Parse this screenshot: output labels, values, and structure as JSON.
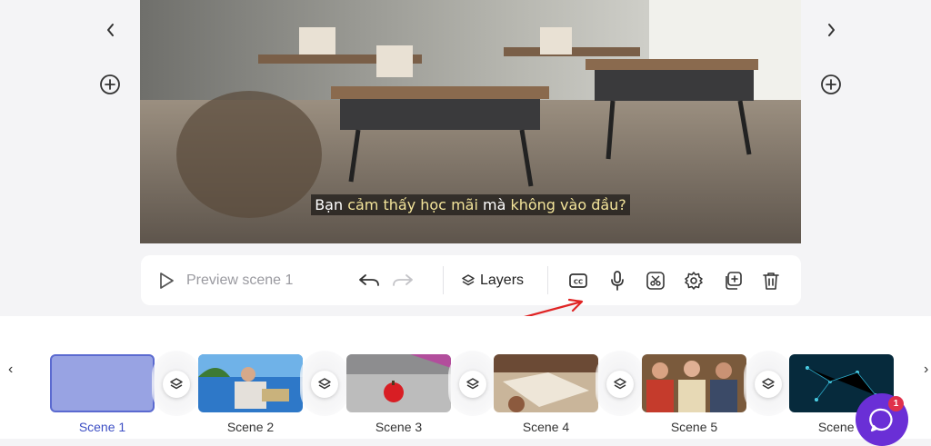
{
  "editor": {
    "subtitle_parts": [
      "Bạn ",
      "cảm thấy học mãi",
      " mà ",
      "không vào đầu?"
    ],
    "nav_prev_icon": "chevron-left-icon",
    "nav_next_icon": "chevron-right-icon",
    "add_left_icon": "add-circle-icon",
    "add_right_icon": "add-circle-icon"
  },
  "toolbar": {
    "preview_label": "Preview scene 1",
    "layers_label": "Layers",
    "icons": [
      "play-icon",
      "undo-icon",
      "redo-icon",
      "layers-icon",
      "closed-captions-icon",
      "microphone-icon",
      "scissors-icon",
      "settings-icon",
      "duplicate-icon",
      "trash-icon"
    ]
  },
  "timeline": {
    "scenes": [
      {
        "label": "Scene 1",
        "active": true
      },
      {
        "label": "Scene 2",
        "active": false
      },
      {
        "label": "Scene 3",
        "active": false
      },
      {
        "label": "Scene 4",
        "active": false
      },
      {
        "label": "Scene 5",
        "active": false
      },
      {
        "label": "Scene 6",
        "active": false
      }
    ],
    "prev_arrow": "‹",
    "next_arrow": "›"
  },
  "chat": {
    "badge_count": "1"
  },
  "colors": {
    "accent": "#5b6ad0",
    "active_label": "#3d4fc4",
    "chat": "#6a2fd6",
    "badge": "#e0314b",
    "annotation_arrow": "#e02424"
  }
}
